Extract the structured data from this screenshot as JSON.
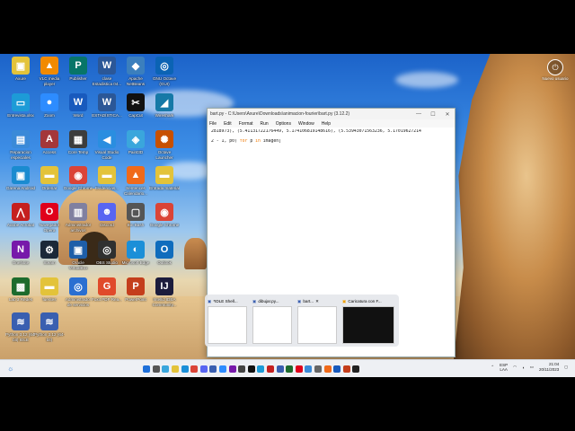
{
  "desktop_icons": [
    {
      "label": "Axure",
      "color": "#e3c33a",
      "glyph": "▣"
    },
    {
      "label": "VLC media player",
      "color": "#f28a00",
      "glyph": "▲"
    },
    {
      "label": "Publisher",
      "color": "#077568",
      "glyph": "P"
    },
    {
      "label": "clase Estadistica 04...",
      "color": "#2b5797",
      "glyph": "W"
    },
    {
      "label": "Apache NetBeans",
      "color": "#3b7fbd",
      "glyph": "◆"
    },
    {
      "label": "GNU Octave (GUI)",
      "color": "#0b63b4",
      "glyph": "◎"
    },
    {
      "label": "Entrevista.xlsx",
      "color": "#1d9bd7",
      "glyph": "▭"
    },
    {
      "label": "Zoom",
      "color": "#2d8cff",
      "glyph": "●"
    },
    {
      "label": "Word",
      "color": "#185abd",
      "glyph": "W"
    },
    {
      "label": "ESTADÍSTICA...",
      "color": "#2b5797",
      "glyph": "W"
    },
    {
      "label": "CapCut",
      "color": "#111111",
      "glyph": "✂"
    },
    {
      "label": "Wireshark",
      "color": "#1679a7",
      "glyph": "◢"
    },
    {
      "label": "Reparacion especiales",
      "color": "#3a8ad8",
      "glyph": "▤"
    },
    {
      "label": "Access",
      "color": "#a4373a",
      "glyph": "A"
    },
    {
      "label": "Core Temp",
      "color": "#3d3d3d",
      "glyph": "▦"
    },
    {
      "label": "Visual Studio Code",
      "color": "#2a8ee0",
      "glyph": "◀"
    },
    {
      "label": "Paint3D",
      "color": "#3aa6dc",
      "glyph": "◈"
    },
    {
      "label": "Octave Launcher",
      "color": "#c75000",
      "glyph": "✺"
    },
    {
      "label": "Garena Android",
      "color": "#1a8bd0",
      "glyph": "▣"
    },
    {
      "label": "Ordenar",
      "color": "#e3c33a",
      "glyph": "▬"
    },
    {
      "label": "Google Chrome",
      "color": "#db4437",
      "glyph": "◉"
    },
    {
      "label": "Evidencias...",
      "color": "#e3c33a",
      "glyph": "▬"
    },
    {
      "label": "Sentences Calendario...",
      "color": "#f06a1a",
      "glyph": "▲"
    },
    {
      "label": "Entrada material",
      "color": "#e3c33a",
      "glyph": "▬"
    },
    {
      "label": "Adobe Acrobat",
      "color": "#c5201f",
      "glyph": "⋀"
    },
    {
      "label": "Navegador Opera",
      "color": "#e0001b",
      "glyph": "O"
    },
    {
      "label": "Administrador archivos",
      "color": "#8080a0",
      "glyph": "▥"
    },
    {
      "label": "Discord",
      "color": "#5865f2",
      "glyph": "☻"
    },
    {
      "label": "Bin Bash",
      "color": "#555555",
      "glyph": "▢"
    },
    {
      "label": "Google Chrome",
      "color": "#db4437",
      "glyph": "◉"
    },
    {
      "label": "OneNote",
      "color": "#7719aa",
      "glyph": "N"
    },
    {
      "label": "Steam",
      "color": "#1b2838",
      "glyph": "⚙"
    },
    {
      "label": "Oracle VirtualBox",
      "color": "#1e5ea8",
      "glyph": "▣"
    },
    {
      "label": "OBS Studio",
      "color": "#303030",
      "glyph": "◎"
    },
    {
      "label": "Microsoft Edge",
      "color": "#1b8fd8",
      "glyph": "◐"
    },
    {
      "label": "Outlook",
      "color": "#0f6cbd",
      "glyph": "O"
    },
    {
      "label": "Lab 3 Redes",
      "color": "#1d6b2d",
      "glyph": "▩"
    },
    {
      "label": "fuentes",
      "color": "#e3c33a",
      "glyph": "▬"
    },
    {
      "label": "Administrador de servicios",
      "color": "#2a6fd1",
      "glyph": "◎"
    },
    {
      "label": "Foxit PDF Rea...",
      "color": "#e04a2a",
      "glyph": "G"
    },
    {
      "label": "PowerPoint",
      "color": "#c43e1c",
      "glyph": "P"
    },
    {
      "label": "IntelliJ IDEA Community...",
      "color": "#1c1c3c",
      "glyph": "IJ"
    },
    {
      "label": "Python 3.12 (64-bit) IDLE",
      "color": "#3a5fb0",
      "glyph": "≋"
    },
    {
      "label": "Python 3.12 (64-bit)",
      "color": "#3a5fb0",
      "glyph": "≋"
    }
  ],
  "user": {
    "label": "Nuevo usuario"
  },
  "window": {
    "title": "bart.py - C:\\Users\\Axure\\Downloads\\animacion-fourier\\bart.py (3.12.2)",
    "menu": [
      "File",
      "Edit",
      "Format",
      "Run",
      "Options",
      "Window",
      "Help"
    ],
    "line1": "2818973), (5.41131722176449, 5.174106819148616), (5.53943071563236, 5.17019627214",
    "line2_a": "2 - 1, p0) ",
    "line2_kw1": "for",
    "line2_b": " p ",
    "line2_kw2": "in",
    "line2_c": " imagen]"
  },
  "thumbs": [
    {
      "label": "*IDLE Shell..."
    },
    {
      "label": "dibujar.py..."
    },
    {
      "label": "bart..."
    },
    {
      "label": "Caricatura con F..."
    }
  ],
  "tray": {
    "lang1": "ESP",
    "lang2": "LAA",
    "time": "21:04",
    "date": "20/11/2023"
  }
}
